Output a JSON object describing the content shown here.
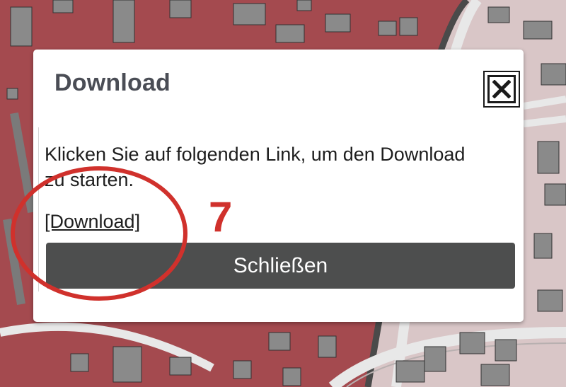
{
  "dialog": {
    "title": "Download",
    "close_icon": "close-x-icon",
    "body_text": "Klicken Sie auf folgenden Link, um den Download zu starten.",
    "download_link": "[Download]",
    "close_button_label": "Schließen"
  },
  "annotation": {
    "number": "7",
    "color": "#d0312c"
  },
  "colors": {
    "map_red_area": "#a44a4f",
    "map_pink_area": "#d9c6c7",
    "map_building": "#8a8a8a",
    "map_road": "#e6e6e6",
    "button_bg": "#4d4e4e",
    "title_color": "#4a4d55"
  }
}
